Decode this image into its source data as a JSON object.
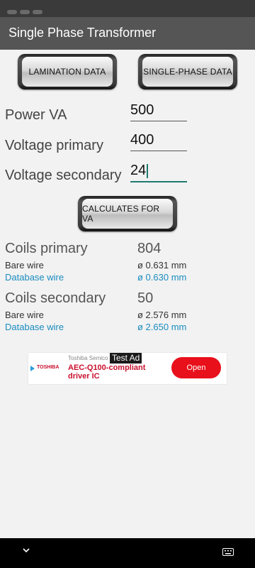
{
  "app": {
    "title": "Single Phase Transformer"
  },
  "buttons": {
    "lamination": "LAMINATION DATA",
    "single_phase": "SINGLE-PHASE DATA",
    "calculate": "CALCULATES FOR VA"
  },
  "inputs": {
    "power_label": "Power VA",
    "power_value": "500",
    "vprimary_label": "Voltage primary",
    "vprimary_value": "400",
    "vsecondary_label": "Voltage secondary",
    "vsecondary_value": "24"
  },
  "results": {
    "primary": {
      "label": "Coils primary",
      "value": "804",
      "bare_label": "Bare wire",
      "bare_value": "ø 0.631 mm",
      "db_label": "Database wire",
      "db_value": "ø 0.630 mm"
    },
    "secondary": {
      "label": "Coils secondary",
      "value": "50",
      "bare_label": "Bare wire",
      "bare_value": "ø 2.576 mm",
      "db_label": "Database wire",
      "db_value": "ø 2.650 mm"
    }
  },
  "ad": {
    "badge": "Test Ad",
    "brand": "TOSHIBA",
    "sponsor": "Toshiba Semico",
    "headline": "AEC-Q100-compliant driver IC",
    "cta": "Open"
  },
  "icons": {
    "nav_back": "chevron-down-icon",
    "nav_keyboard": "keyboard-icon",
    "ad_choice": "play-triangle-icon"
  },
  "colors": {
    "appbar": "#555555",
    "accent": "#1f7a6e",
    "link_blue": "#1a8cc0",
    "ad_red": "#e8101a"
  }
}
